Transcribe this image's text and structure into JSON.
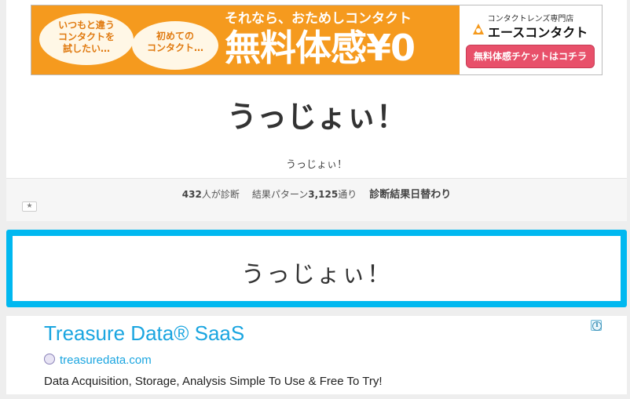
{
  "banner": {
    "cloud1_text": "いつもと違う\nコンタクトを\n試したい…",
    "cloud2_text": "初めての\nコンタクト…",
    "tagline": "それなら、おためしコンタクト",
    "big_text": "無料体感¥0",
    "brand_sub": "コンタクトレンズ専門店",
    "brand_name": "エースコンタクト",
    "ticket_button": "無料体感チケットはコチラ",
    "orange_color": "#f59a1e"
  },
  "page": {
    "title": "うっじょぃ！",
    "subtitle": "うっじょぃ！"
  },
  "stats": {
    "diagnosed_count": "432",
    "diagnosed_suffix": "人が診断",
    "patterns_prefix": "結果パターン",
    "patterns_count": "3,125",
    "patterns_suffix": "通り",
    "daily_label": "診断結果日替わり",
    "favorite_icon": "star-icon",
    "favorite_glyph": "★"
  },
  "diagnosis": {
    "title": "うっじょぃ！",
    "accent_color": "#00b8f0"
  },
  "ad": {
    "headline": "Treasure Data® SaaS",
    "url": "treasuredata.com",
    "description": "Data Acquisition, Storage, Analysis Simple To Use & Free To Try!",
    "link_color": "#1aa5e0"
  }
}
